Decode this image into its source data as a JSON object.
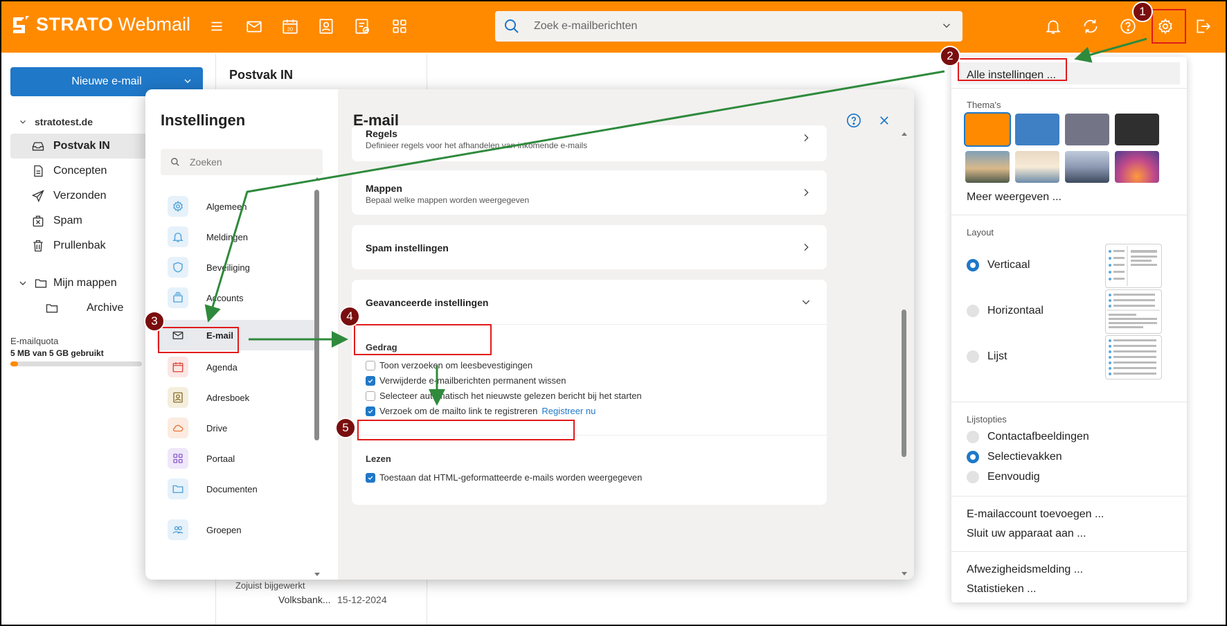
{
  "header": {
    "logo_bold": "STRATO",
    "logo_light": "Webmail",
    "search_placeholder": "Zoek e-mailberichten"
  },
  "sidebar": {
    "new_mail_label": "Nieuwe e-mail",
    "account": "stratotest.de",
    "folders": [
      {
        "label": "Postvak IN",
        "icon": "inbox-icon"
      },
      {
        "label": "Concepten",
        "icon": "draft-icon"
      },
      {
        "label": "Verzonden",
        "icon": "send-icon"
      },
      {
        "label": "Spam",
        "icon": "spam-icon"
      },
      {
        "label": "Prullenbak",
        "icon": "trash-icon"
      },
      {
        "label": "Mijn mappen",
        "icon": "folder-icon"
      },
      {
        "label": "Archive",
        "icon": "folder-icon"
      }
    ],
    "quota_label": "E-mailquota",
    "quota_value": "5 MB van 5 GB gebruikt",
    "quota_fraction": 0.06
  },
  "mail_list": {
    "title": "Postvak IN",
    "updated": "Zojuist bijgewerkt",
    "sender": "Volksbank...",
    "date": "15-12-2024"
  },
  "settings_dialog": {
    "title": "Instellingen",
    "search_placeholder": "Zoeken",
    "nav": [
      {
        "label": "Algemeen",
        "icon": "gear-icon",
        "color": "#4a9fd8"
      },
      {
        "label": "Meldingen",
        "icon": "bell-icon",
        "color": "#4a9fd8"
      },
      {
        "label": "Beveiliging",
        "icon": "shield-icon",
        "color": "#4a9fd8"
      },
      {
        "label": "Accounts",
        "icon": "accounts-icon",
        "color": "#4a9fd8"
      },
      {
        "label": "E-mail",
        "icon": "envelope-icon",
        "color": "#444444"
      },
      {
        "label": "Agenda",
        "icon": "calendar-icon",
        "color": "#d9453a"
      },
      {
        "label": "Adresboek",
        "icon": "contacts-icon",
        "color": "#8a6d2a"
      },
      {
        "label": "Drive",
        "icon": "cloud-icon",
        "color": "#e8793a"
      },
      {
        "label": "Portaal",
        "icon": "grid-icon",
        "color": "#8a5cc8"
      },
      {
        "label": "Documenten",
        "icon": "folder-icon",
        "color": "#4a9fd8"
      },
      {
        "label": "Groepen",
        "icon": "groups-icon",
        "color": "#4a9fd8"
      }
    ],
    "panel_title": "E-mail",
    "cards": [
      {
        "title": "Regels",
        "subtitle": "Definieer regels voor het afhandelen van inkomende e-mails"
      },
      {
        "title": "Mappen",
        "subtitle": "Bepaal welke mappen worden weergegeven"
      },
      {
        "title": "Spam instellingen",
        "subtitle": ""
      }
    ],
    "advanced_title": "Geavanceerde instellingen",
    "behavior_title": "Gedrag",
    "behavior_options": [
      {
        "label": "Toon verzoeken om leesbevestigingen",
        "checked": false
      },
      {
        "label": "Verwijderde e-mailberichten permanent wissen",
        "checked": true
      },
      {
        "label": "Selecteer automatisch het nieuwste gelezen bericht bij het starten",
        "checked": false
      },
      {
        "label": "Verzoek om de mailto link te registreren",
        "checked": true
      }
    ],
    "register_link": "Registreer nu",
    "read_title": "Lezen",
    "read_options": [
      {
        "label": "Toestaan dat HTML-geformatteerde e-mails worden weergegeven",
        "checked": true
      }
    ]
  },
  "quick_settings": {
    "all_settings": "Alle instellingen ...",
    "themes_title": "Thema's",
    "theme_colors": [
      "#ff8a00",
      "#3f7fc4",
      "#737587",
      "#2f2f2f"
    ],
    "more_label": "Meer weergeven ...",
    "layout_title": "Layout",
    "layout_options": [
      {
        "label": "Verticaal",
        "selected": true
      },
      {
        "label": "Horizontaal",
        "selected": false
      },
      {
        "label": "Lijst",
        "selected": false
      }
    ],
    "list_options_title": "Lijstopties",
    "list_options": [
      {
        "label": "Contactafbeeldingen",
        "selected": false
      },
      {
        "label": "Selectievakken",
        "selected": true
      },
      {
        "label": "Eenvoudig",
        "selected": false
      }
    ],
    "actions": [
      "E-mailaccount toevoegen ...",
      "Sluit uw apparaat aan ..."
    ],
    "actions2": [
      "Afwezigheidsmelding ...",
      "Statistieken ..."
    ]
  },
  "annotations": [
    "1",
    "2",
    "3",
    "4",
    "5"
  ]
}
